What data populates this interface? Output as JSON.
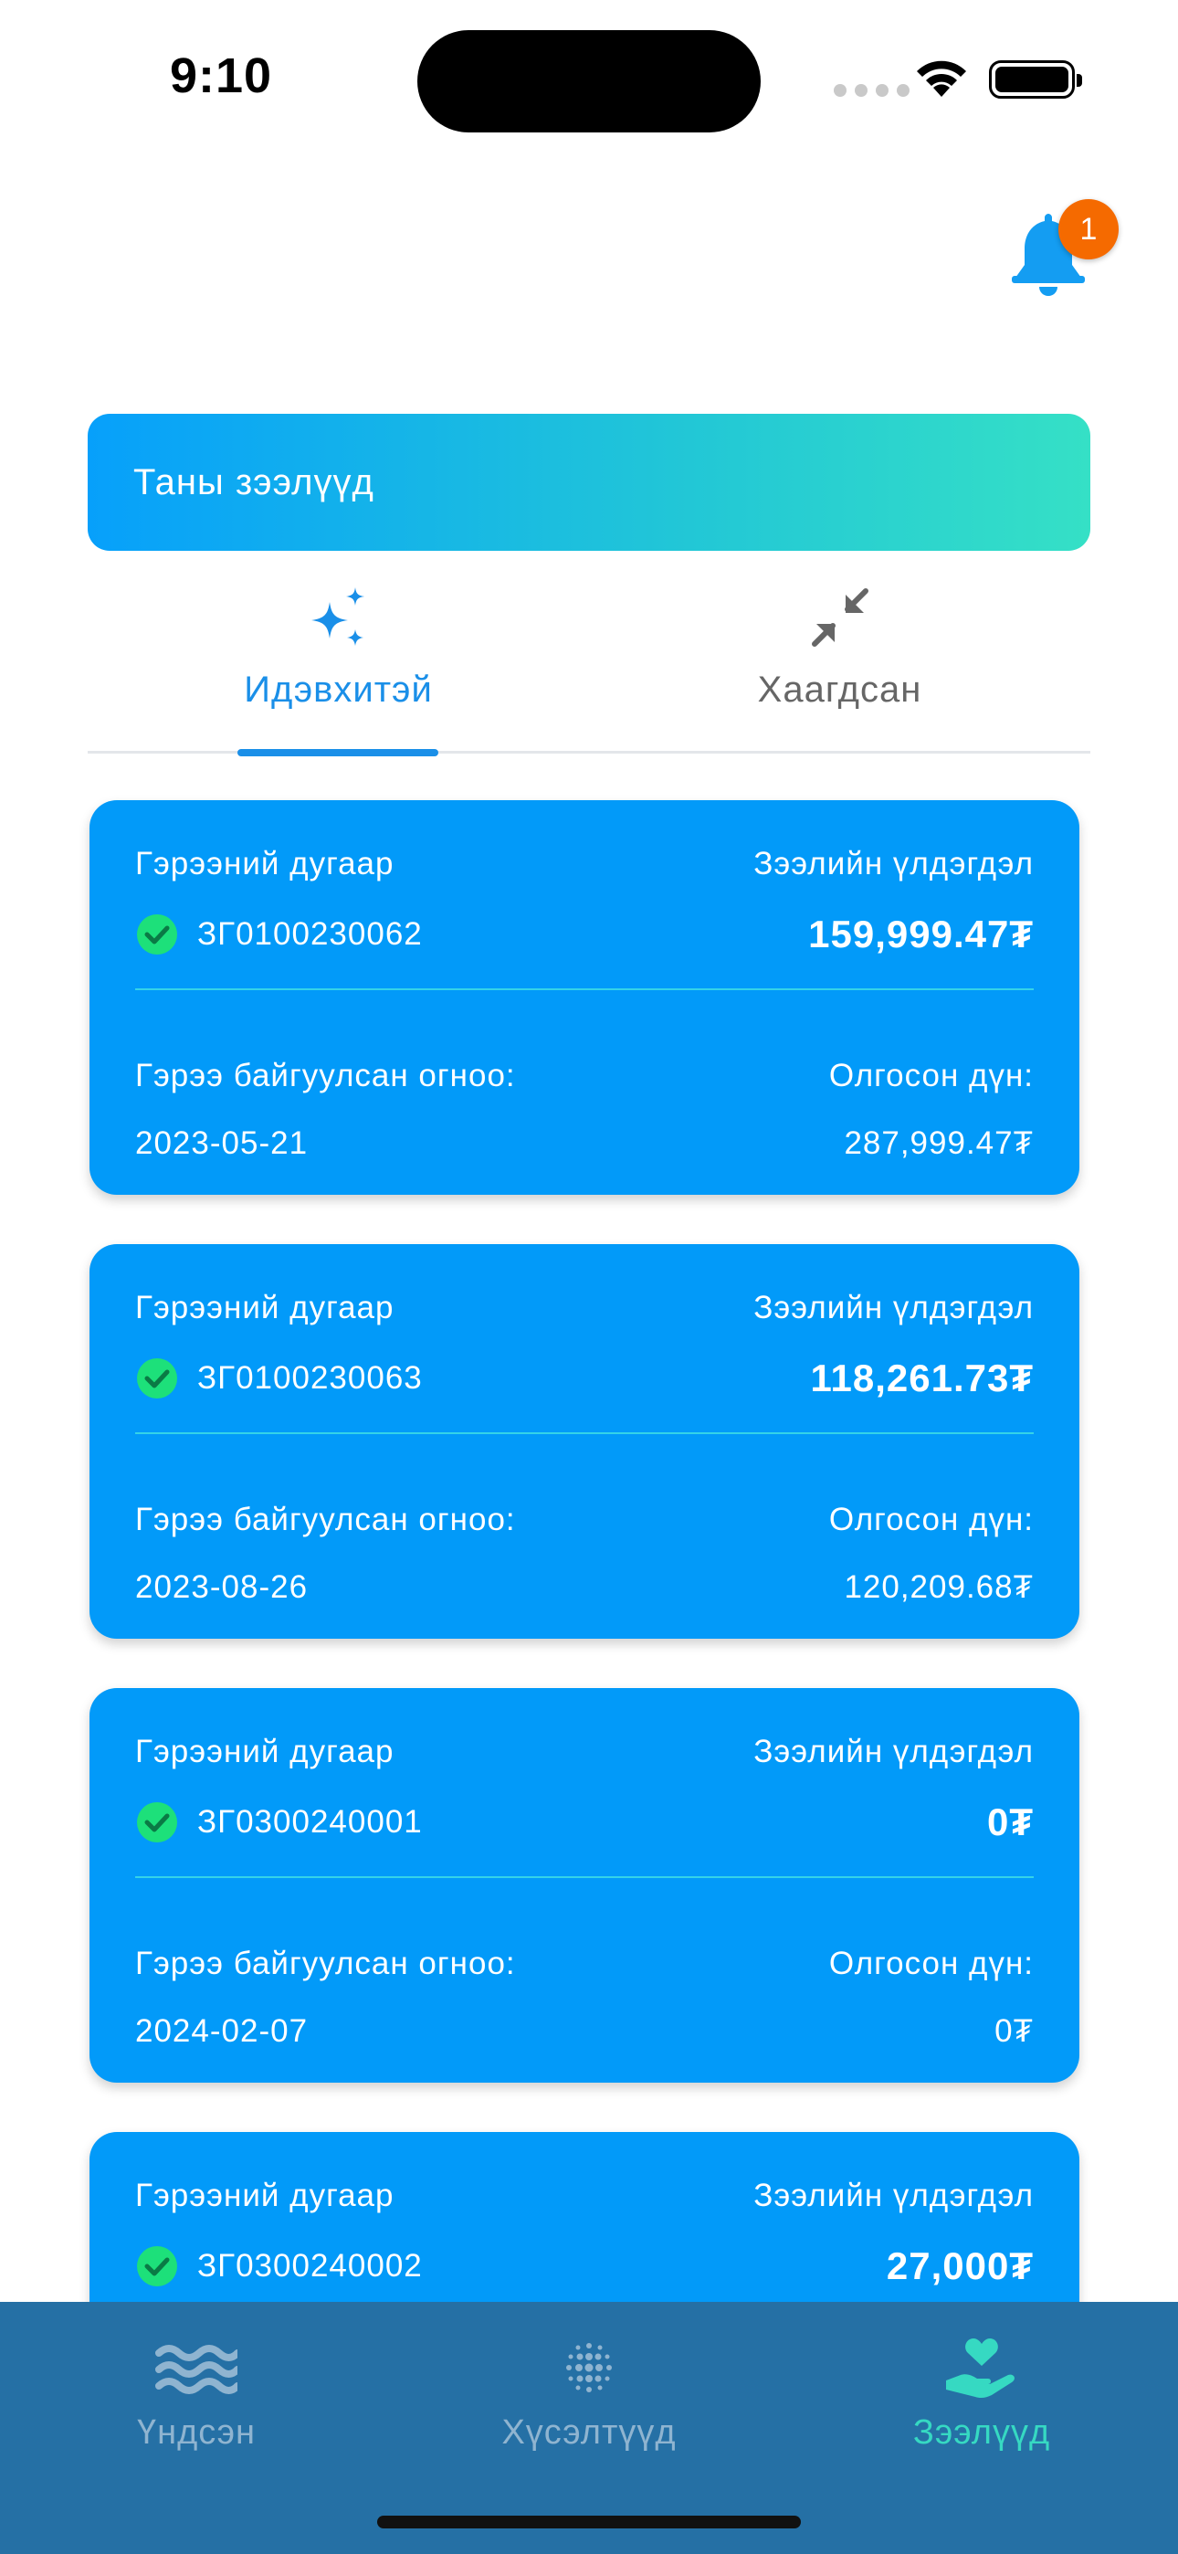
{
  "status_bar": {
    "time": "9:10"
  },
  "notifications": {
    "badge_count": "1"
  },
  "banner": {
    "title": "Таны зээлүүд"
  },
  "tabs": [
    {
      "label": "Идэвхитэй",
      "icon": "sparkles-icon",
      "active": true
    },
    {
      "label": "Хаагдсан",
      "icon": "collapse-arrows-icon",
      "active": false
    }
  ],
  "loan_labels": {
    "contract": "Гэрээний дугаар",
    "balance": "Зээлийн үлдэгдэл",
    "date": "Гэрээ байгуулсан огноо:",
    "paid": "Олгосон дүн:"
  },
  "loans": [
    {
      "contract_no": "ЗГ0100230062",
      "balance": "159,999.47₮",
      "date": "2023-05-21",
      "paid": "287,999.47₮"
    },
    {
      "contract_no": "ЗГ0100230063",
      "balance": "118,261.73₮",
      "date": "2023-08-26",
      "paid": "120,209.68₮"
    },
    {
      "contract_no": "ЗГ0300240001",
      "balance": "0₮",
      "date": "2024-02-07",
      "paid": "0₮"
    },
    {
      "contract_no": "ЗГ0300240002",
      "balance": "27,000₮"
    }
  ],
  "bottom_nav": [
    {
      "label": "Үндсэн",
      "icon": "waves-icon"
    },
    {
      "label": "Хүсэлтүүд",
      "icon": "dots-grid-icon"
    },
    {
      "label": "Зээлүүд",
      "icon": "hand-heart-icon",
      "active": true
    }
  ],
  "colors": {
    "card": "#029af9",
    "accent": "#1a8fe8",
    "nav_bg": "#2570a5",
    "nav_active": "#36d9c2",
    "badge": "#f56a00",
    "check": "#1de07a"
  }
}
